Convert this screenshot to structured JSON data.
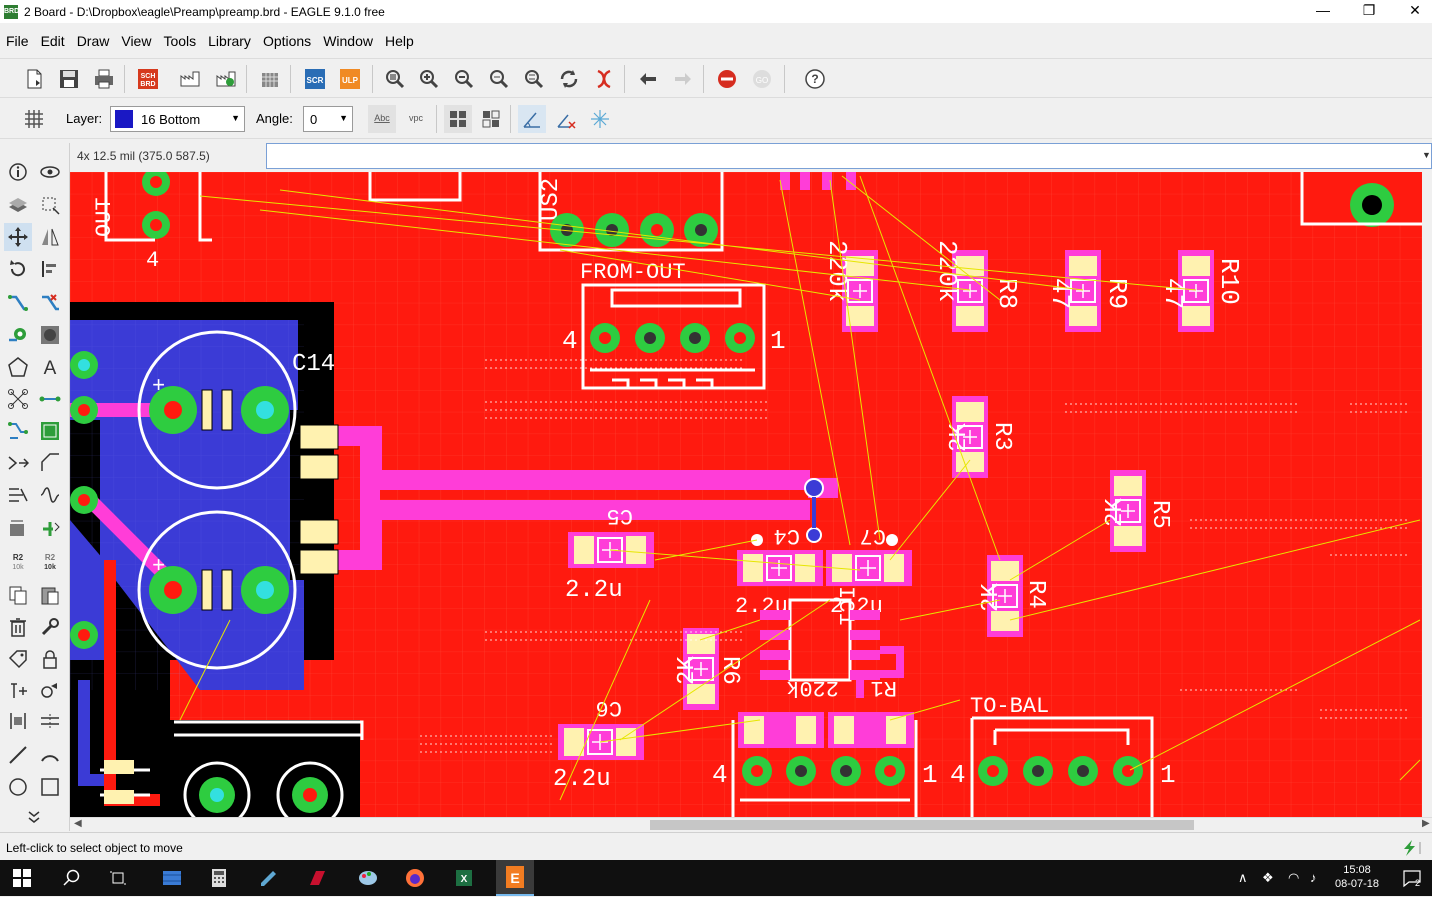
{
  "window": {
    "title": "2 Board - D:\\Dropbox\\eagle\\Preamp\\preamp.brd - EAGLE 9.1.0 free",
    "controls": {
      "minimize": "—",
      "maximize": "❐",
      "close": "✕"
    }
  },
  "menu": [
    "File",
    "Edit",
    "Draw",
    "View",
    "Tools",
    "Library",
    "Options",
    "Window",
    "Help"
  ],
  "toolbar": {
    "sch_brd": "SCH BRD",
    "scr": "SCR",
    "ulp": "ULP"
  },
  "parameters": {
    "layer_label": "Layer:",
    "layer_value": "16 Bottom",
    "layer_color": "#1a18c4",
    "angle_label": "Angle:",
    "angle_value": "0",
    "abc": "Abc",
    "vpc": "vpc"
  },
  "coordinates": "4x 12.5 mil (375.0 587.5)",
  "command_line": "",
  "left_tools": {
    "r2_label": "R2",
    "r2_value": "10k",
    "r2b_label": "R2",
    "r2b_value": "10k"
  },
  "board": {
    "colors": {
      "top_copper": "#ff1a0f",
      "bottom_copper": "#3b3bd6",
      "background": "#000000",
      "pad": "#2ecc40",
      "silk": "#ffffff",
      "smd": "#fff2b0",
      "via": "#ff3dd8",
      "airwire": "#e6e600"
    },
    "labels": {
      "out": "OUT",
      "out_pin": "4",
      "us2": "US2",
      "from_out": "FROM-OUT",
      "from_out_4": "4",
      "from_out_1": "1",
      "c14": "C14",
      "c5": "C5",
      "c5_val": "2.2u",
      "c6": "C6",
      "c6_val": "2.2u",
      "c4": "C4",
      "c4_val": "2.2u",
      "c7": "C7",
      "c7_val": "2.2u",
      "ic1": "IC1",
      "r1": "R1",
      "r1_val": "220k",
      "r2": "R2",
      "r2_val": "220k",
      "r3": "R3",
      "r3_val": "2K",
      "r4": "R4",
      "r4_val": "2K",
      "r5": "R5",
      "r5_val": "2K",
      "r6": "R6",
      "r6_val": "2K",
      "r8": "R8",
      "r8_val": "220k",
      "r9": "R9",
      "r9_val": "47",
      "r10": "R10",
      "r10_val": "47",
      "to_bal": "TO-BAL",
      "to_bal_4": "4",
      "to_bal_1": "1",
      "bottom_conn_4": "4",
      "bottom_conn_1": "1"
    }
  },
  "status": "Left-click to select object to move",
  "taskbar": {
    "time": "15:08",
    "date": "08-07-18",
    "notifications": "2"
  }
}
